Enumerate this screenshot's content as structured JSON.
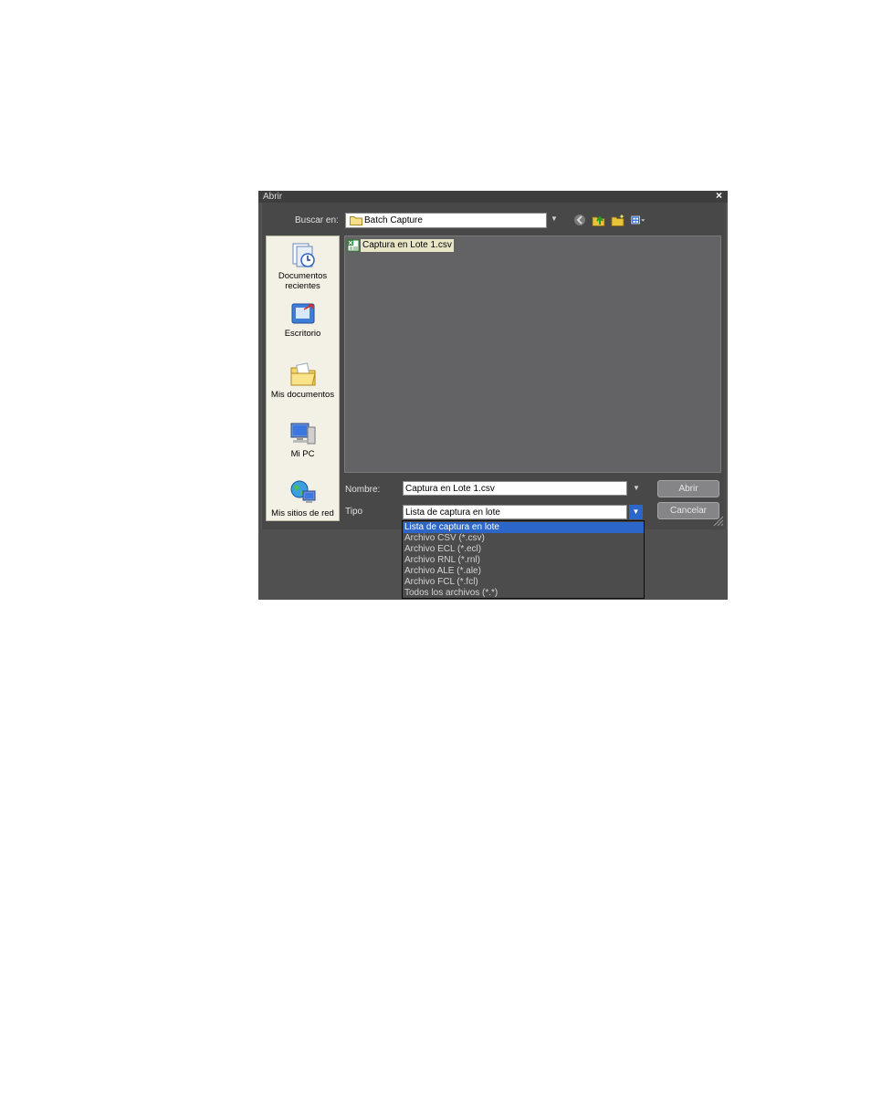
{
  "dialog": {
    "title": "Abrir",
    "close_symbol": "×"
  },
  "lookin": {
    "label": "Buscar en:",
    "value": "Batch Capture",
    "icon": "folder-icon"
  },
  "toolbar": {
    "icons": [
      "back-icon",
      "up-folder-icon",
      "new-folder-icon",
      "views-menu-icon"
    ]
  },
  "places": [
    {
      "label": "Documentos recientes",
      "icon": "recent-documents-icon"
    },
    {
      "label": "Escritorio",
      "icon": "desktop-icon"
    },
    {
      "label": "Mis documentos",
      "icon": "my-documents-icon"
    },
    {
      "label": "Mi PC",
      "icon": "my-computer-icon"
    },
    {
      "label": "Mis sitios de red",
      "icon": "network-places-icon"
    }
  ],
  "files": [
    {
      "name": "Captura en Lote 1.csv",
      "icon": "csv-file-icon"
    }
  ],
  "form": {
    "name_label": "Nombre:",
    "name_value": "Captura en Lote 1.csv",
    "type_label": "Tipo",
    "type_value": "Lista de captura en lote"
  },
  "buttons": {
    "open": "Abrir",
    "cancel": "Cancelar"
  },
  "type_options": [
    "Lista de captura en lote",
    "Archivo CSV (*.csv)",
    "Archivo ECL (*.ecl)",
    "Archivo RNL (*.rnl)",
    "Archivo ALE (*.ale)",
    "Archivo FCL (*.fcl)",
    "Todos los archivos (*.*)"
  ],
  "selected_type_index": 0,
  "colors": {
    "dialog_bg": "#4f4f50",
    "selection": "#2d66c9",
    "file_area": "#636365",
    "places_bg": "#f3f0e5"
  }
}
